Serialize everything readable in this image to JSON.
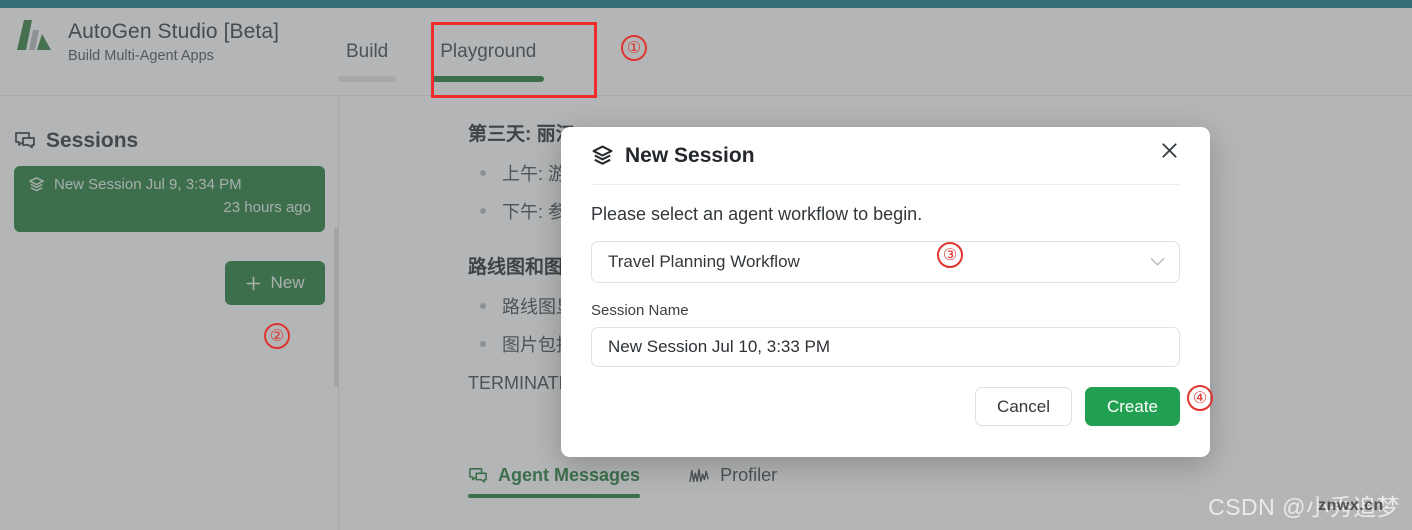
{
  "app": {
    "brand_title": "AutoGen Studio [Beta]",
    "brand_subtitle": "Build Multi-Agent Apps",
    "logo_icon": "autogen-logo-icon",
    "accent_green": "#1d7a34",
    "create_green": "#22a052",
    "topbar_teal": "#0f7b8a",
    "annotation_red": "#e0342f"
  },
  "nav": {
    "tabs": [
      {
        "label": "Build",
        "active": false
      },
      {
        "label": "Playground",
        "active": true
      }
    ]
  },
  "sidebar": {
    "title": "Sessions",
    "title_icon": "chat-bubbles-icon",
    "session": {
      "icon": "layers-icon",
      "name": "New Session Jul 9, 3:34 PM",
      "ago": "23 hours ago"
    },
    "new_button": {
      "label": "New",
      "icon": "plus-icon"
    }
  },
  "main": {
    "content": [
      {
        "type": "heading",
        "text": "第三天: 丽江"
      },
      {
        "type": "bullet",
        "text": "上午: 游"
      },
      {
        "type": "bullet",
        "text": "下午: 参"
      },
      {
        "type": "heading",
        "text": "路线图和图"
      },
      {
        "type": "bullet",
        "text": "路线图显"
      },
      {
        "type": "bullet",
        "text": "图片包括"
      },
      {
        "type": "plain",
        "text": "TERMINATE"
      }
    ],
    "bottom_tabs": [
      {
        "label": "Agent Messages",
        "icon": "chat-bubbles-icon",
        "active": true
      },
      {
        "label": "Profiler",
        "icon": "activity-icon",
        "active": false
      }
    ]
  },
  "modal": {
    "title": "New Session",
    "title_icon": "layers-icon",
    "close_icon": "close-icon",
    "description": "Please select an agent workflow to begin.",
    "workflow_select": {
      "value": "Travel Planning Workflow",
      "chevron_icon": "chevron-down-icon"
    },
    "session_name": {
      "label": "Session Name",
      "value": "New Session Jul 10, 3:33 PM",
      "placeholder": "Session Name"
    },
    "cancel_label": "Cancel",
    "create_label": "Create"
  },
  "annotations": {
    "marks": [
      {
        "id": "1",
        "text": "①"
      },
      {
        "id": "2",
        "text": "②"
      },
      {
        "id": "3",
        "text": "③"
      },
      {
        "id": "4",
        "text": "④"
      }
    ]
  },
  "watermark": {
    "text": "CSDN @小秀追梦",
    "sub": "znwx.cn"
  }
}
